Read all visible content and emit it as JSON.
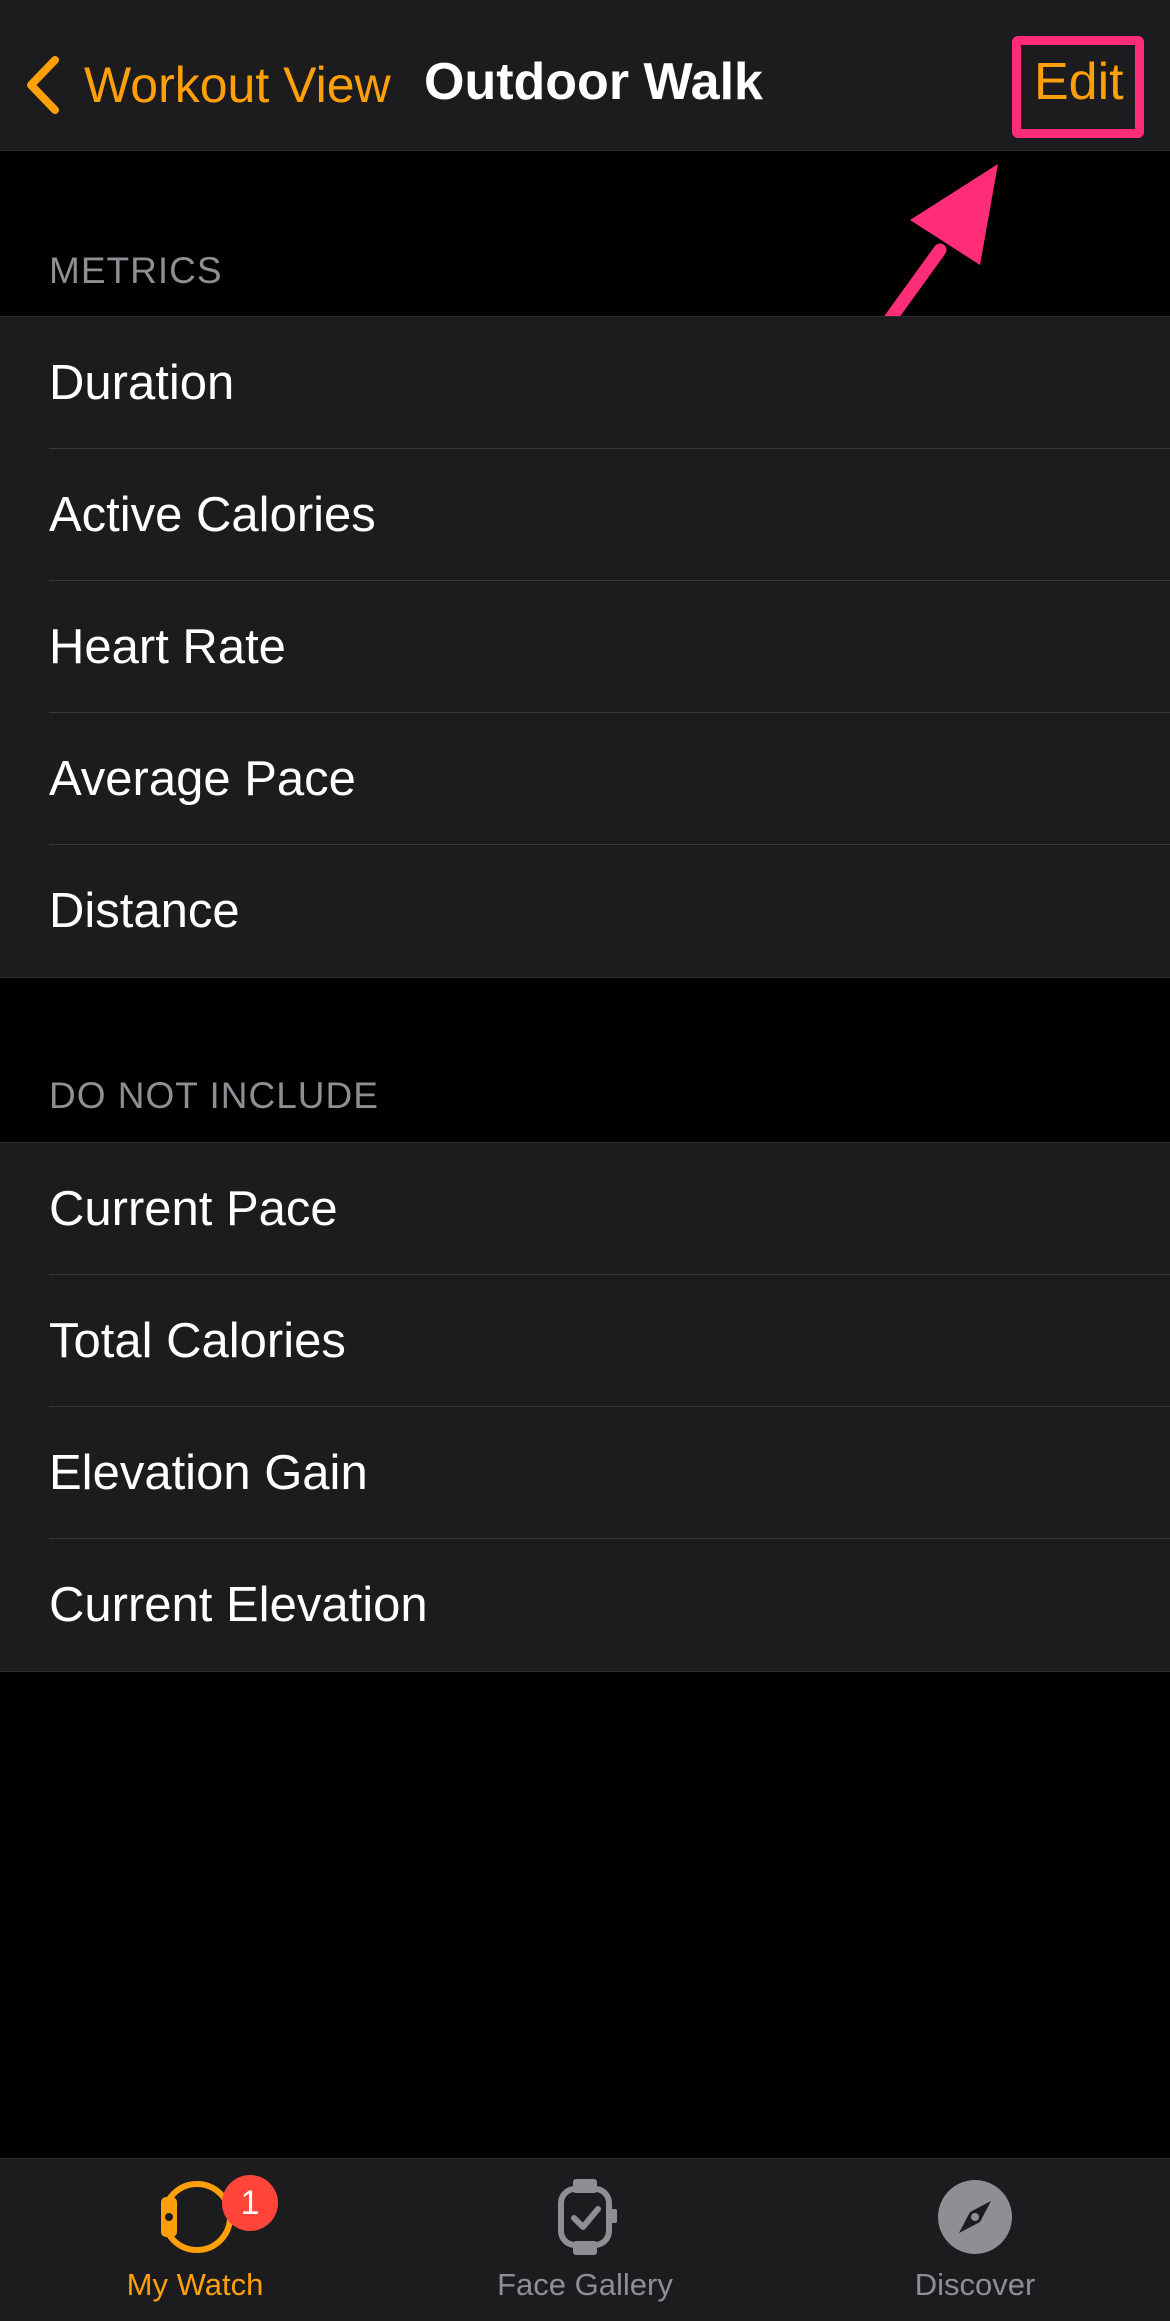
{
  "nav": {
    "back_label": "Workout View",
    "title": "Outdoor Walk",
    "edit_label": "Edit"
  },
  "sections": [
    {
      "header": "METRICS",
      "items": [
        "Duration",
        "Active Calories",
        "Heart Rate",
        "Average Pace",
        "Distance"
      ]
    },
    {
      "header": "DO NOT INCLUDE",
      "items": [
        "Current Pace",
        "Total Calories",
        "Elevation Gain",
        "Current Elevation"
      ]
    }
  ],
  "tabbar": {
    "tabs": [
      {
        "label": "My Watch",
        "icon": "watch-icon",
        "selected": true
      },
      {
        "label": "Face Gallery",
        "icon": "face-gallery-icon",
        "selected": false
      },
      {
        "label": "Discover",
        "icon": "compass-icon",
        "selected": false
      }
    ],
    "badge": "1"
  },
  "colors": {
    "accent": "#ff9f0a",
    "annotation": "#ff2d78",
    "badge": "#ff453a",
    "background": "#000000",
    "cell": "#1c1c1e",
    "secondary_text": "#8e8e93"
  }
}
